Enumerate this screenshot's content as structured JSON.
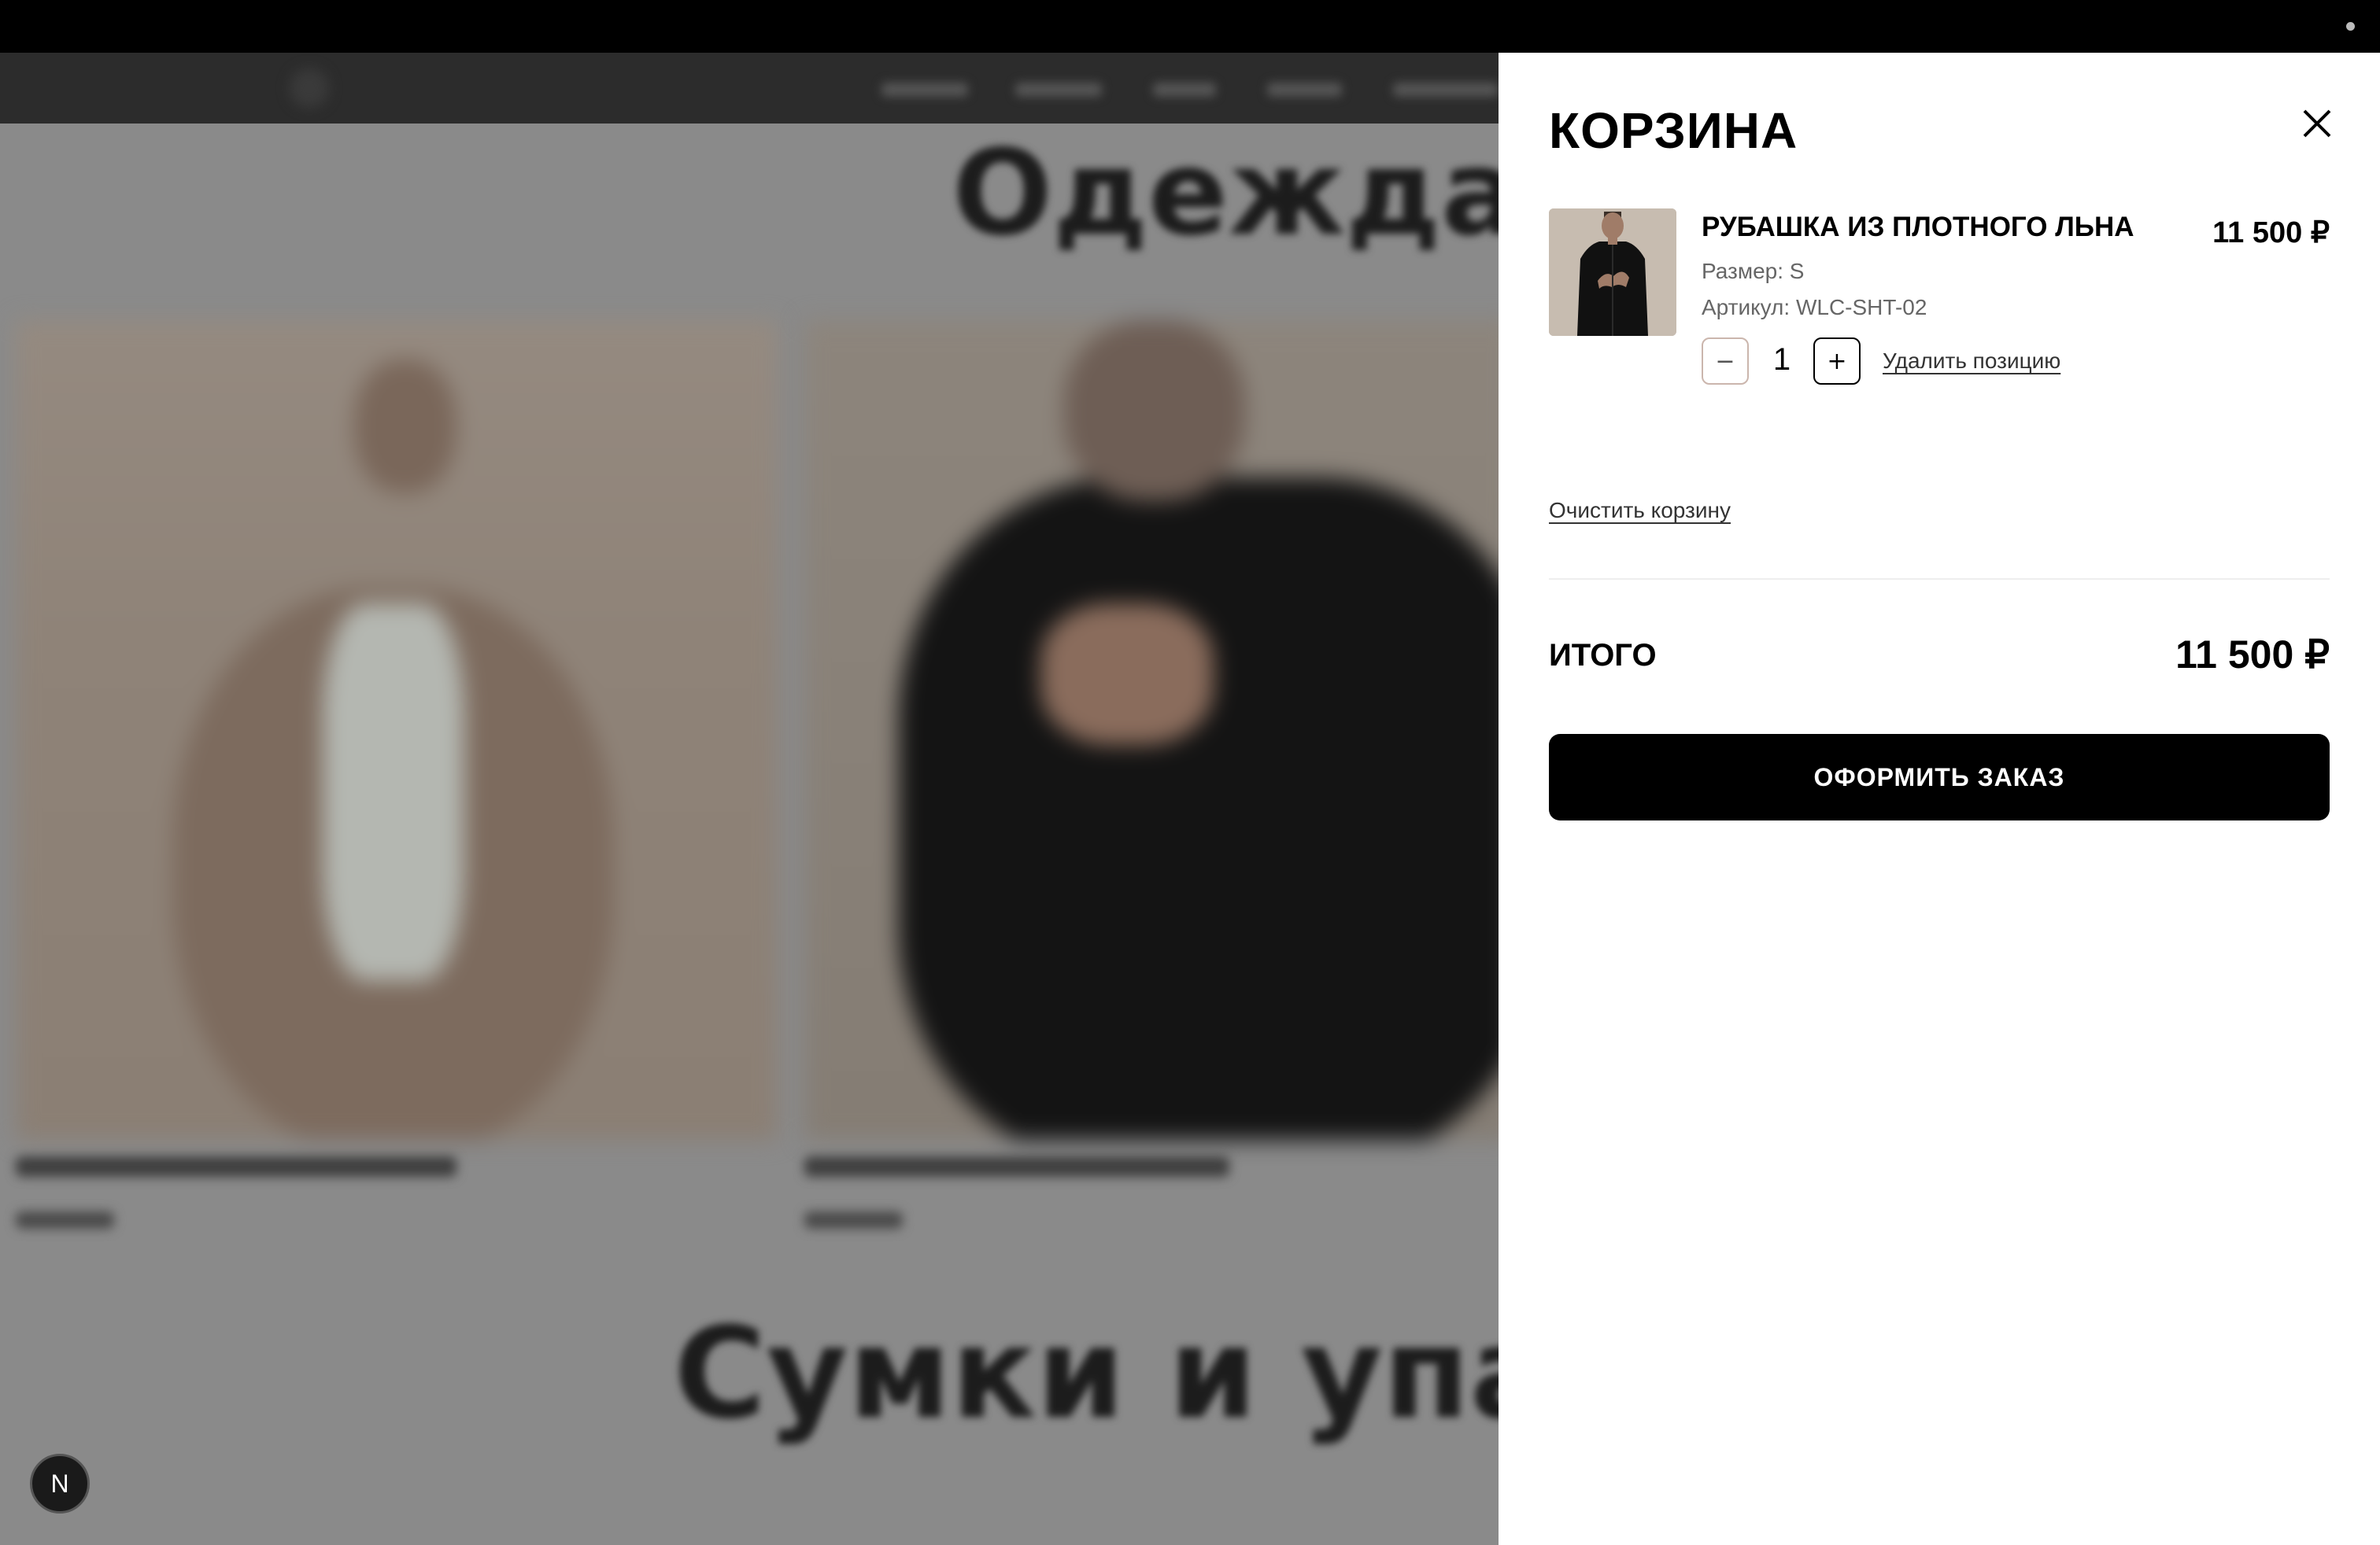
{
  "background_page": {
    "section_clothes_title": "Одежда",
    "section_bags_title": "Сумки и упако"
  },
  "badge": {
    "letter": "N"
  },
  "cart": {
    "title": "КОРЗИНА",
    "close_icon": "close-icon",
    "item": {
      "name": "РУБАШКА ИЗ ПЛОТНОГО ЛЬНА",
      "price": "11 500 ₽",
      "size": "Размер: S",
      "sku": "Артикул: WLC-SHT-02",
      "quantity": "1",
      "minus_label": "−",
      "plus_label": "+",
      "remove_label": "Удалить позицию"
    },
    "clear_label": "Очистить корзину",
    "total_label": "ИТОГО",
    "total_value": "11 500 ₽",
    "checkout_label": "ОФОРМИТЬ ЗАКАЗ"
  },
  "colors": {
    "overlay": "#8a8a8a",
    "drawer": "#ffffff",
    "accent": "#000000",
    "minus_border": "#cbb6ad"
  }
}
